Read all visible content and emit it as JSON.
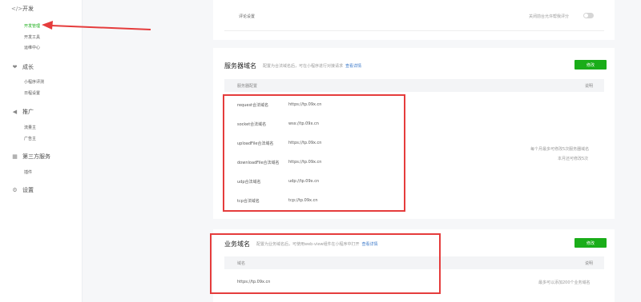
{
  "sidebar": {
    "groups": [
      {
        "label": "开发",
        "icon": "code-icon"
      },
      {
        "label": "成长",
        "icon": "growth-icon"
      },
      {
        "label": "推广",
        "icon": "megaphone-icon"
      },
      {
        "label": "第三方服务",
        "icon": "grid-icon"
      },
      {
        "label": "设置",
        "icon": "gear-icon"
      }
    ],
    "items": {
      "dev_manage": "开发管理",
      "dev_tools": "开发工具",
      "monitor": "运维中心",
      "mini_game": "小程序评测",
      "log": "日程设置",
      "mini_ad": "流量主",
      "ad_manage": "广告主",
      "plugin": "插件"
    }
  },
  "top_card": {
    "label": "评论设置",
    "toggle_label": "关闭前台允许帮我评分"
  },
  "server_domain": {
    "title": "服务器域名",
    "desc": "配置为合法域名后，可在小程序进行对接请求",
    "link": "查看详情",
    "button": "修改",
    "col_name": "服务器配置",
    "col_action": "说明",
    "rows": [
      {
        "name": "request合法域名",
        "value": "https://tp.09x.cn"
      },
      {
        "name": "socket合法域名",
        "value": "wss://tp.09x.cn"
      },
      {
        "name": "uploadFile合法域名",
        "value": "https://tp.09x.cn"
      },
      {
        "name": "downloadFile合法域名",
        "value": "https://tp.09x.cn"
      },
      {
        "name": "udp合法域名",
        "value": "udp://tp.09x.cn"
      },
      {
        "name": "tcp合法域名",
        "value": "tcp://tp.09x.cn"
      }
    ],
    "note_line1": "每个月最多可修改5次服务器域名",
    "note_line2": "本月还可修改5次"
  },
  "business_domain": {
    "title": "业务域名",
    "desc": "配置为业务域名后，可使用web-view组件在小程序中打开",
    "link": "查看详情",
    "button": "修改",
    "col_name": "域名",
    "col_action": "说明",
    "row_value": "https://tp.09x.cn",
    "note": "最多可以添加200个业务域名"
  },
  "colors": {
    "accent": "#1aad19",
    "highlight": "#e53c3c",
    "link": "#3a78c9"
  }
}
